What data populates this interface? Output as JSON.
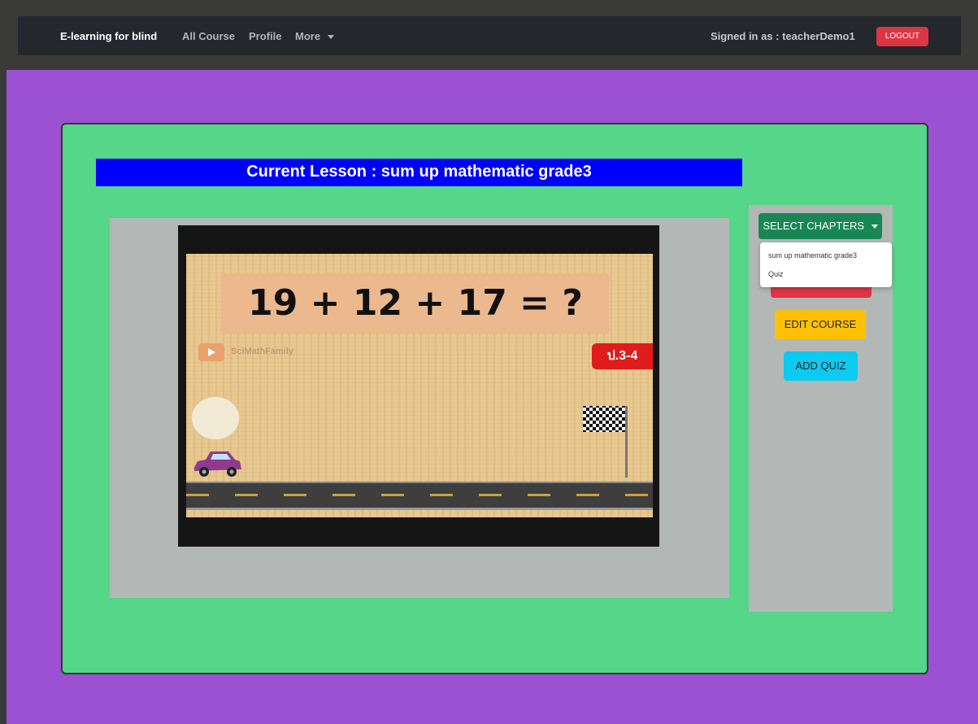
{
  "navbar": {
    "brand": "E-learning for blind",
    "links": [
      "All Course",
      "Profile",
      "More"
    ],
    "signed_in": "Signed in as : teacherDemo1",
    "logout_label": "LOGOUT"
  },
  "lesson": {
    "title": "Current Lesson : sum up mathematic grade3"
  },
  "video": {
    "equation": "19 + 12 + 17 = ?",
    "channel": "SciMathFamily",
    "grade_badge": "ป.3-4"
  },
  "sidebar": {
    "select_label": "SELECT CHAPTERS",
    "dropdown_items": [
      "sum up mathematic grade3",
      "Quiz"
    ],
    "edit_label": "EDIT COURSE",
    "add_quiz_label": "ADD QUIZ"
  },
  "colors": {
    "navbar": "#24272b",
    "background": "#9b51d1",
    "card": "#55d689",
    "lesson_bar": "#0000fe",
    "logout": "#dc3545",
    "select": "#198754",
    "edit": "#ffc107",
    "add_quiz": "#0dcaf0"
  }
}
